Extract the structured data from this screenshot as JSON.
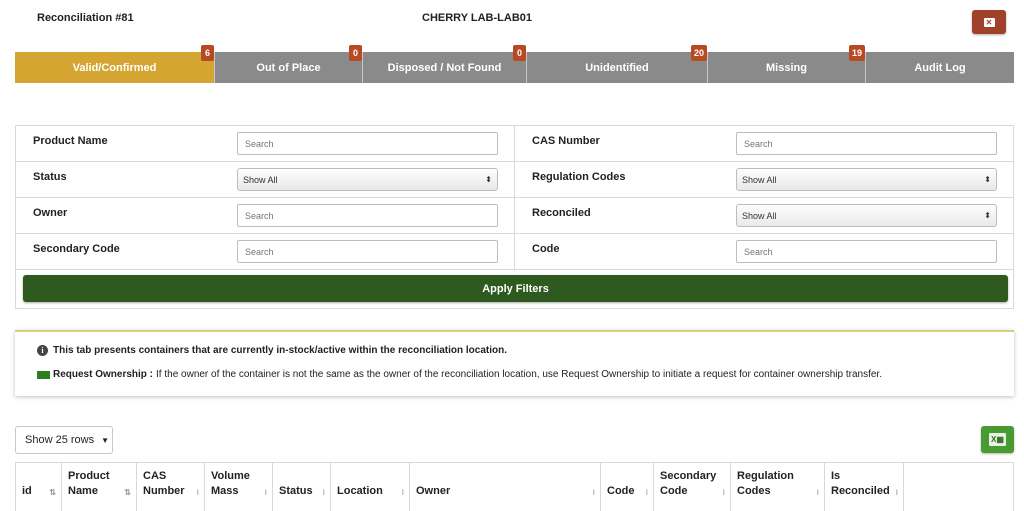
{
  "header": {
    "title": "Reconciliation #81",
    "location": "CHERRY LAB-LAB01",
    "close_icon": "close-icon"
  },
  "tabs": [
    {
      "label": "Valid/Confirmed",
      "count": "6",
      "active": true
    },
    {
      "label": "Out of Place",
      "count": "0",
      "active": false
    },
    {
      "label": "Disposed / Not Found",
      "count": "0",
      "active": false
    },
    {
      "label": "Unidentified",
      "count": "20",
      "active": false
    },
    {
      "label": "Missing",
      "count": "19",
      "active": false
    },
    {
      "label": "Audit Log",
      "count": "",
      "active": false
    }
  ],
  "filters": {
    "product_name": {
      "label": "Product Name",
      "placeholder": "Search"
    },
    "cas_number": {
      "label": "CAS Number",
      "placeholder": "Search"
    },
    "status": {
      "label": "Status",
      "value": "Show All"
    },
    "regulation_codes": {
      "label": "Regulation Codes",
      "value": "Show All"
    },
    "owner": {
      "label": "Owner",
      "placeholder": "Search"
    },
    "reconciled": {
      "label": "Reconciled",
      "value": "Show All"
    },
    "secondary_code": {
      "label": "Secondary Code",
      "placeholder": "Search"
    },
    "code": {
      "label": "Code",
      "placeholder": "Search"
    },
    "apply_label": "Apply Filters"
  },
  "info": {
    "line1": "This tab presents containers that are currently in-stock/active within the reconciliation location.",
    "request_label": "Request Ownership :",
    "request_text": "If the owner of the container is not the same as the owner of the reconciliation location, use Request Ownership to initiate a request for container ownership transfer."
  },
  "table": {
    "rows_label": "Show 25 rows",
    "columns": [
      "id",
      "Product Name",
      "CAS Number",
      "Volume Mass",
      "Status",
      "Location",
      "Owner",
      "Code",
      "Secondary Code",
      "Regulation Codes",
      "Is Reconciled",
      ""
    ]
  },
  "colors": {
    "active_tab": "#d4a531",
    "inactive_tab": "#8a8a8a",
    "badge": "#b84a23",
    "apply_button": "#2e5a1f",
    "excel_button": "#4a9a32"
  }
}
